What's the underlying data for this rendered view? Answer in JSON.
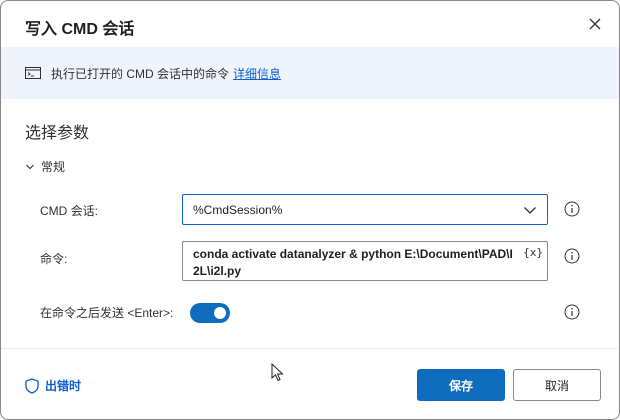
{
  "dialog": {
    "title": "写入 CMD 会话"
  },
  "info_bar": {
    "text": "执行已打开的 CMD 会话中的命令",
    "link": "详细信息",
    "icon": "cmd-icon"
  },
  "section": {
    "title": "选择参数",
    "group": "常规"
  },
  "fields": {
    "session": {
      "label": "CMD 会话:",
      "value": "%CmdSession%"
    },
    "command": {
      "label": "命令:",
      "value": "conda activate datanalyzer & python E:\\Document\\PAD\\I2L\\i2l.py",
      "var_button": "{x}"
    },
    "send_enter": {
      "label": "在命令之后发送 <Enter>:",
      "enabled": true
    }
  },
  "footer": {
    "on_error": "出错时",
    "save": "保存",
    "cancel": "取消"
  },
  "colors": {
    "accent": "#0f6cbd",
    "link": "#0f5fd1",
    "info_bg": "#eff4fc"
  }
}
